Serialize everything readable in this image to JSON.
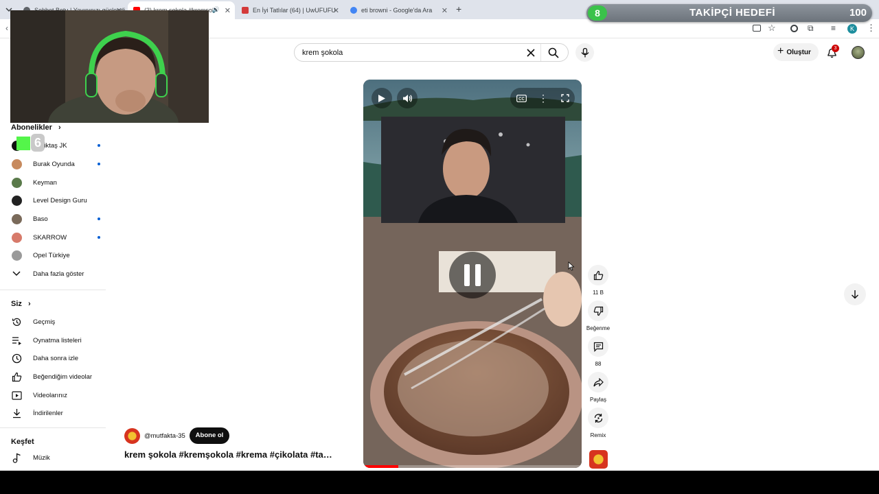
{
  "browser": {
    "tabs": [
      {
        "title": "Sohbet Botu | Yayınınızı güçlendi…",
        "color": "#5f6368"
      },
      {
        "title": "(3) krem şokola #kremşok…",
        "color": "#ff0000"
      },
      {
        "title": "En İyi Tatlılar (64) | UwUFUFU",
        "color": "#d43a3a"
      },
      {
        "title": "eti browni - Google'da Ara",
        "color": "#4285f4"
      }
    ],
    "profile_initial": "K"
  },
  "overlay": {
    "follow_count": "8",
    "follow_label": "TAKİPÇİ HEDEFİ",
    "follow_target": "100",
    "streak_badge": "6"
  },
  "header": {
    "search_value": "krem şokola",
    "create_label": "Oluştur",
    "notification_count": "3"
  },
  "sidebar": {
    "subscriptions_title": "Abonelikler",
    "subscriptions": [
      {
        "label": "Beşiktaş JK",
        "dot": true,
        "color": "#111111"
      },
      {
        "label": "Burak Oyunda",
        "dot": true,
        "color": "#c78a5e"
      },
      {
        "label": "Keyman",
        "dot": false,
        "color": "#5a7a4a"
      },
      {
        "label": "Level Design Guru",
        "dot": false,
        "color": "#222222"
      },
      {
        "label": "Baso",
        "dot": true,
        "color": "#7a6a5a"
      },
      {
        "label": "SKARROW",
        "dot": true,
        "color": "#d77a6a"
      },
      {
        "label": "Opel Türkiye",
        "dot": false,
        "color": "#9a9a9a"
      }
    ],
    "show_more": "Daha fazla göster",
    "you_title": "Siz",
    "you_items": [
      "Geçmiş",
      "Oynatma listeleri",
      "Daha sonra izle",
      "Beğendiğim videolar",
      "Videolarınız",
      "İndirilenler"
    ],
    "explore_title": "Keşfet",
    "explore_items": [
      "Müzik"
    ]
  },
  "short": {
    "channel": "@mutfakta-35",
    "subscribe_label": "Abone ol",
    "title": "krem şokola #kremşokola #krema #çikolata #ta…",
    "progress": 0.16,
    "actions": {
      "like_count": "11 B",
      "dislike_label": "Beğenme",
      "comment_count": "88",
      "share_label": "Paylaş",
      "remix_label": "Remix"
    }
  }
}
